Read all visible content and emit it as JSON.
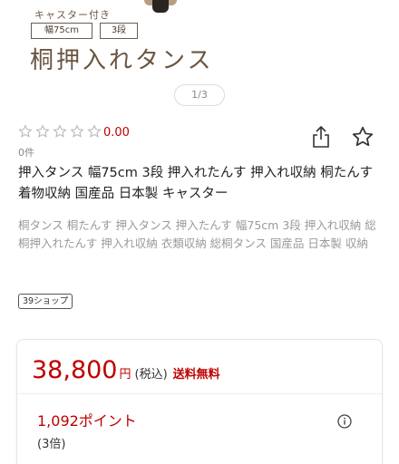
{
  "hero": {
    "caption": "キャスター付き",
    "tags": [
      "幅75cm",
      "3段"
    ],
    "title": "桐押入れタンス"
  },
  "gallery": {
    "pager": "1/3"
  },
  "rating": {
    "value": "0.00",
    "count": "0件",
    "stars_filled": 0,
    "stars_total": 5
  },
  "product": {
    "title": "押入タンス 幅75cm 3段 押入れたんす 押入れ収納 桐たんす 着物収納 国産品 日本製 キャスター",
    "keywords": "桐タンス 桐たんす 押入タンス 押入たんす 幅75cm 3段 押入れ収納 総桐押入れたんす 押入れ収納 衣類収納 総桐タンス 国産品 日本製 収納"
  },
  "shop": {
    "badge": "39ショップ"
  },
  "price": {
    "amount": "38,800",
    "unit": "円",
    "tax": "(税込)",
    "shipping": "送料無料",
    "points": "1,092ポイント",
    "multiplier": "(3倍)"
  },
  "colors": {
    "accent": "#bf0000",
    "muted": "#9a9a9a",
    "hero_text": "#6a5542"
  },
  "icons": {
    "share": "share-icon",
    "favorite": "star-outline-icon",
    "info": "info-icon"
  }
}
